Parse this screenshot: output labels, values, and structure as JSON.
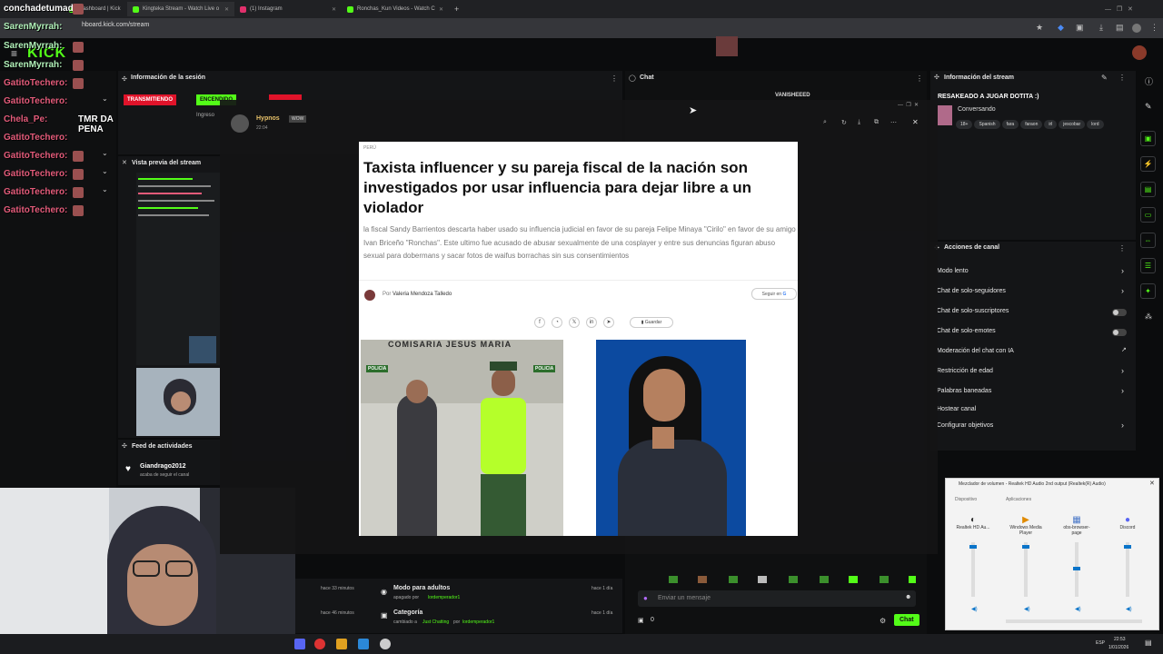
{
  "browser": {
    "tabs": [
      {
        "label": "Dashboard | Kick",
        "color": "#53fc18"
      },
      {
        "label": "Kingteka Stream - Watch Live o",
        "color": "#53fc18"
      },
      {
        "label": "(1) Instagram",
        "color": "#e1306c"
      },
      {
        "label": "Ronchas_Kun Videos - Watch C",
        "color": "#53fc18"
      }
    ],
    "url": "hboard.kick.com/stream"
  },
  "chat_overlay": [
    {
      "name": "conchadetumadre",
      "style": "white"
    },
    {
      "name": "SarenMyrrah:",
      "style": "green"
    },
    {
      "name": "SarenMyrrah:",
      "style": "green"
    },
    {
      "name": "SarenMyrrah:",
      "style": "green"
    },
    {
      "name": "GatitoTechero:",
      "style": "pink"
    },
    {
      "name": "GatitoTechero:",
      "style": "pink"
    },
    {
      "name": "Chela_Pe:",
      "style": "pink"
    },
    {
      "name": "GatitoTechero:",
      "style": "pink"
    },
    {
      "name": "GatitoTechero:",
      "style": "pink"
    },
    {
      "name": "GatitoTechero:",
      "style": "pink"
    },
    {
      "name": "GatitoTechero:",
      "style": "pink"
    },
    {
      "name": "GatitoTechero:",
      "style": "pink"
    }
  ],
  "overlay_message": "TMR DA PENA",
  "kick": {
    "logo": "KICK",
    "session_title": "Información de la sesión",
    "live_badge": "TRANSMITIENDO",
    "encendido": "ENCENDIDO",
    "ingreso": "Ingreso",
    "preview_title": "Vista previa del stream",
    "activity_title": "Feed de actividades",
    "activity_user": "Giandrago2012",
    "activity_text": "acaba de seguir el canal",
    "chat_title": "Chat",
    "chat_top_user": "VANISHEEED",
    "chat_placeholder": "Enviar un mensaje",
    "chat_button": "Chat",
    "chat_count": "0"
  },
  "activity_bottom": [
    {
      "time": "hace 33 minutos",
      "title": "Modo para adultos",
      "desc": "apagado por",
      "user": "lordemperador1",
      "when": "hace 1 día"
    },
    {
      "time": "hace 46 minutos",
      "title": "Categoría",
      "desc": "cambiado a",
      "cat": "Just Chatting",
      "by": "por",
      "user": "lordemperador1",
      "when": "hace 1 día"
    }
  ],
  "stream_info": {
    "title": "Información del stream",
    "stream_name": "RESAKEADO A JUGAR DOTITA :)",
    "category": "Conversando",
    "tags": [
      "18+",
      "Spanish",
      "fara",
      "faraon",
      "irl",
      "jescobar",
      "lord"
    ]
  },
  "channel_actions": {
    "title": "Acciones de canal",
    "items": [
      {
        "label": "Modo lento",
        "ctrl": "chevron"
      },
      {
        "label": "Chat de solo-seguidores",
        "ctrl": "chevron"
      },
      {
        "label": "Chat de solo-suscriptores",
        "ctrl": "toggle"
      },
      {
        "label": "Chat de solo-emotes",
        "ctrl": "toggle"
      },
      {
        "label": "Moderación del chat con IA",
        "ctrl": "link"
      },
      {
        "label": "Restricción de edad",
        "ctrl": "chevron"
      },
      {
        "label": "Palabras baneadas",
        "ctrl": "chevron"
      },
      {
        "label": "Hostear canal",
        "ctrl": "none"
      },
      {
        "label": "Configurar objetivos",
        "ctrl": "chevron"
      }
    ]
  },
  "modal": {
    "poster": "Hypnos",
    "badge": "WOW",
    "time": "22:04",
    "section": "PERÚ",
    "headline": "Taxista influencer y su pareja fiscal de la nación son investigados por usar influencia para dejar libre a un violador",
    "lede": "la fiscal Sandy Barrientos descarta haber usado su influencia judicial en favor de su pareja Felipe Minaya \"Cirilo\" en favor de su amigo Ivan Briceño \"Ronchas\". Este ultimo fue acusado de abusar sexualmente de una cosplayer y entre sus denuncias figuran abuso sexual para dobermans y sacar fotos de waifus borrachas sin sus consentimientos",
    "author_prefix": "Por",
    "author": "Valeria Mendoza Talledo",
    "follow": "Seguir en",
    "save": "Guardar",
    "photo_sign": "COMISARIA JESUS MARIA",
    "police_label": "POLICIA"
  },
  "mixer": {
    "title": "Mezclador de volumen - Realtek HD Audio 2nd output (Realtek(R) Audio)",
    "device_label": "Dispositivo",
    "apps_label": "Aplicaciones",
    "channels": [
      {
        "name": "Realtek HD Au...",
        "level": 0.95
      },
      {
        "name": "Windows Media Player",
        "level": 0.95
      },
      {
        "name": "obs-browser-page",
        "level": 0.55
      },
      {
        "name": "Discord",
        "level": 0.95
      }
    ]
  },
  "taskbar": {
    "time": "22:53",
    "date": "1/01/2026",
    "lang": "ESP"
  },
  "colors": {
    "kick_green": "#53fc18",
    "live_red": "#e0132a"
  }
}
